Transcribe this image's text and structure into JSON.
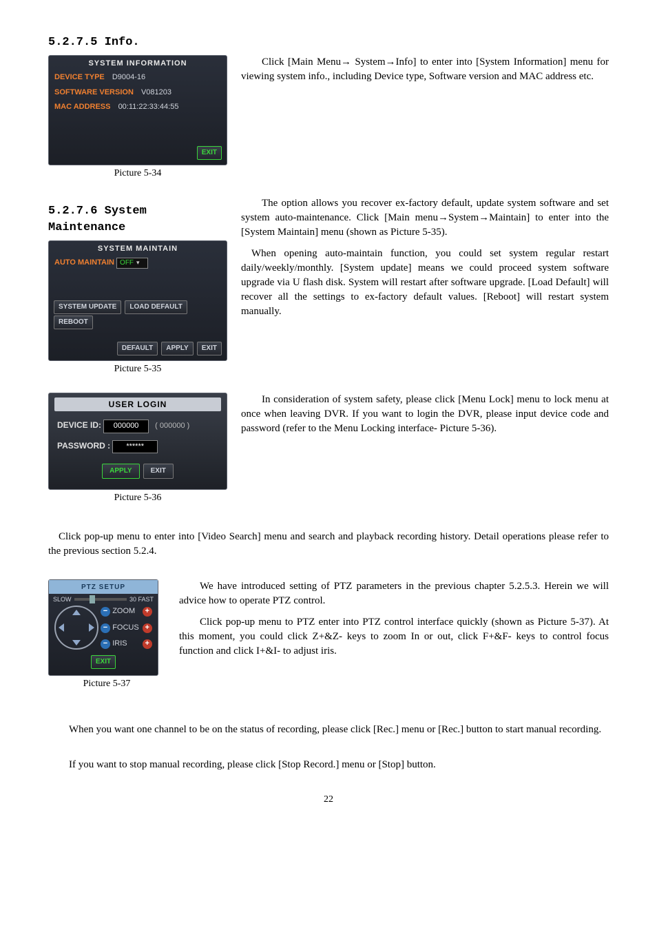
{
  "sec_5_2_7_5": {
    "heading": "5.2.7.5 Info.",
    "panel_title": "SYSTEM INFORMATION",
    "rows": {
      "device_type_label": "DEVICE TYPE",
      "device_type_value": "D9004-16",
      "software_version_label": "SOFTWARE VERSION",
      "software_version_value": "V081203",
      "mac_address_label": "MAC ADDRESS",
      "mac_address_value": "00:11:22:33:44:55"
    },
    "exit": "EXIT",
    "caption": "Picture 5-34",
    "body": "Click [Main Menu→ System→Info] to enter into [System Information] menu for viewing system info., including Device type, Software version and MAC address etc."
  },
  "sec_5_2_7_6": {
    "heading": "5.2.7.6 System Maintenance",
    "panel_title": "SYSTEM MAINTAIN",
    "auto_maintain_label": "AUTO MAINTAIN",
    "auto_maintain_value": "OFF",
    "system_update": "SYSTEM UPDATE",
    "load_default": "LOAD DEFAULT",
    "reboot": "REBOOT",
    "default": "DEFAULT",
    "apply": "APPLY",
    "exit": "EXIT",
    "caption": "Picture 5-35",
    "body1": "The option allows you recover ex-factory default, update system software and set system auto-maintenance. Click [Main menu→System→Maintain] to enter into the [System Maintain] menu (shown as Picture 5-35).",
    "body2": "When opening auto-maintain function, you could set system regular restart daily/weekly/monthly. [System update] means we could proceed system software upgrade via U flash disk. System will restart after software upgrade. [Load Default] will recover all the settings to ex-factory default values. [Reboot] will restart system manually."
  },
  "user_login": {
    "panel_title": "USER  LOGIN",
    "device_id_label": "DEVICE  ID:",
    "device_id_value": "000000",
    "device_id_hint": "( 000000 )",
    "password_label": "PASSWORD  :",
    "password_value": "******",
    "apply": "APPLY",
    "exit": "EXIT",
    "caption": "Picture 5-36",
    "body": "In consideration of system safety, please click [Menu Lock] menu to lock menu at once when leaving DVR. If you want to login the DVR, please input device code and password (refer to the Menu Locking interface- Picture 5-36)."
  },
  "video_search_para": "Click pop-up menu to enter into [Video Search] menu and search and playback recording history. Detail operations please refer to the previous section 5.2.4.",
  "ptz": {
    "panel_title": "PTZ  SETUP",
    "slow": "SLOW",
    "fast": "30 FAST",
    "zoom": "ZOOM",
    "focus": "FOCUS",
    "iris": "IRIS",
    "exit": "EXIT",
    "caption": "Picture 5-37",
    "body1": "We have introduced setting of PTZ parameters in the previous chapter 5.2.5.3. Herein we will advice how to operate PTZ control.",
    "body2": "Click pop-up menu to PTZ enter into PTZ control interface quickly (shown as Picture 5-37). At this moment, you could click Z+&Z- keys to zoom In or out, click F+&F- keys to control focus function and click I+&I- to adjust iris."
  },
  "rec_para": "When you want one channel to be on the status of recording, please click [Rec.] menu or [Rec.] button to start manual recording.",
  "stop_para": "If you want to stop manual recording, please click [Stop Record.] menu or [Stop] button.",
  "page_number": "22"
}
